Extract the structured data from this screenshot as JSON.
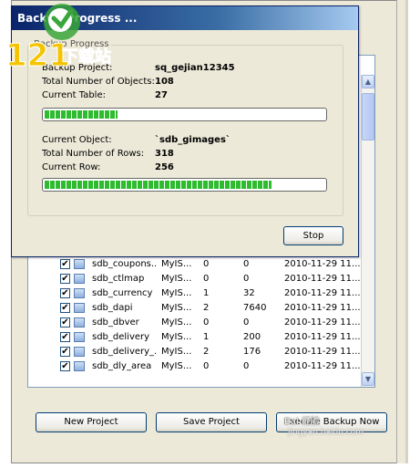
{
  "dialog": {
    "title": "Backup Progress ...",
    "group_label": "Backup Progress",
    "fields": [
      {
        "label": "Backup Project:",
        "value": "sq_gejian12345"
      },
      {
        "label": "Total Number of Objects:",
        "value": "108"
      },
      {
        "label": "Current Table:",
        "value": "27"
      }
    ],
    "table_progress": 0.26,
    "object_fields": [
      {
        "label": "Current Object:",
        "value": "`sdb_gimages`"
      },
      {
        "label": "Total Number of Rows:",
        "value": "318"
      },
      {
        "label": "Current Row:",
        "value": "256"
      }
    ],
    "row_progress": 0.81,
    "stop_label": "Stop"
  },
  "table_list": {
    "rows": [
      {
        "checked": true,
        "name": "sdb_coupons...",
        "type": "MyIS...",
        "a": "0",
        "b": "0",
        "date": "2010-11-29 11..."
      },
      {
        "checked": true,
        "name": "sdb_ctlmap",
        "type": "MyIS...",
        "a": "0",
        "b": "0",
        "date": "2010-11-29 11..."
      },
      {
        "checked": true,
        "name": "sdb_currency",
        "type": "MyIS...",
        "a": "1",
        "b": "32",
        "date": "2010-11-29 11..."
      },
      {
        "checked": true,
        "name": "sdb_dapi",
        "type": "MyIS...",
        "a": "2",
        "b": "7640",
        "date": "2010-11-29 11..."
      },
      {
        "checked": true,
        "name": "sdb_dbver",
        "type": "MyIS...",
        "a": "0",
        "b": "0",
        "date": "2010-11-29 11..."
      },
      {
        "checked": true,
        "name": "sdb_delivery",
        "type": "MyIS...",
        "a": "1",
        "b": "200",
        "date": "2010-11-29 11..."
      },
      {
        "checked": true,
        "name": "sdb_delivery_...",
        "type": "MyIS...",
        "a": "2",
        "b": "176",
        "date": "2010-11-29 11..."
      },
      {
        "checked": true,
        "name": "sdb_dly_area",
        "type": "MyIS...",
        "a": "0",
        "b": "0",
        "date": "2010-11-29 11..."
      }
    ]
  },
  "buttons": {
    "new_project": "New Project",
    "save_project": "Save Project",
    "execute": "Execute Backup Now"
  },
  "watermark": {
    "logo_digits": "121",
    "logo_text": "下载站",
    "bottom_text": "Bai 经验",
    "url": "jingyan.baidu.com"
  },
  "colors": {
    "progress_green": "#2fbb2f",
    "titlebar": "#0a246a"
  }
}
